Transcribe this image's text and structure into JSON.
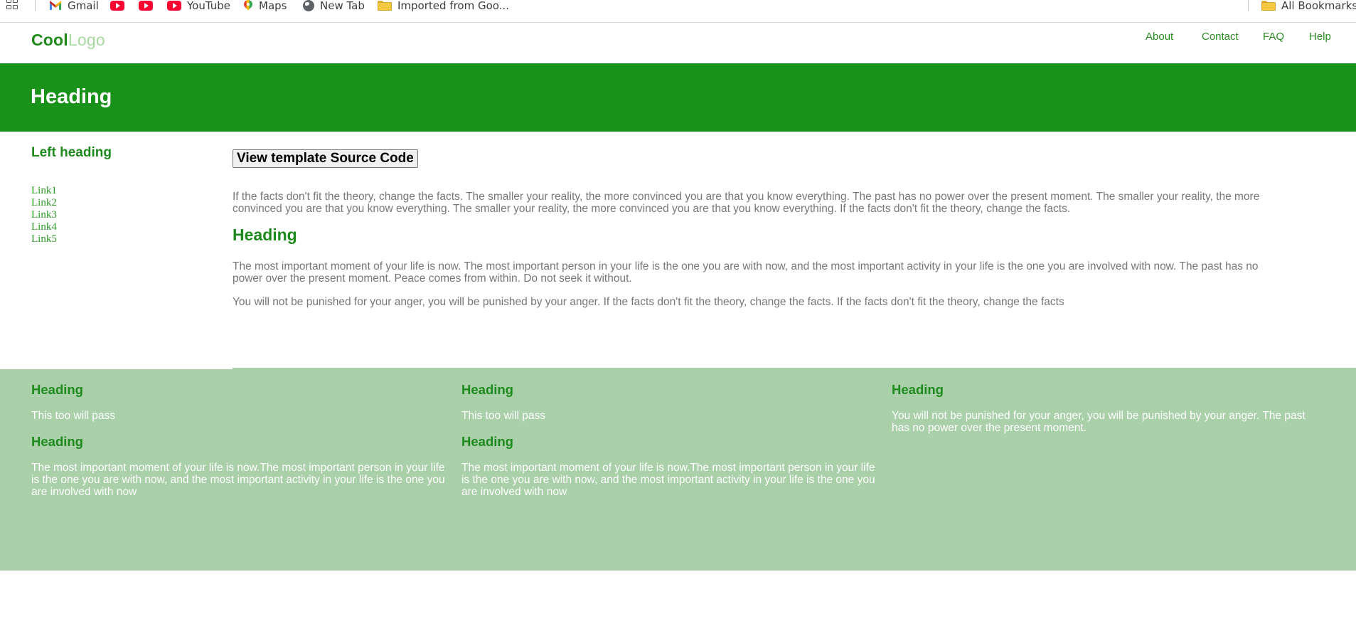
{
  "bookmarks_bar": {
    "items": [
      {
        "label": "Gmail",
        "icon": "gmail-icon"
      },
      {
        "label": "",
        "icon": "youtube-icon"
      },
      {
        "label": "",
        "icon": "youtube-icon"
      },
      {
        "label": "YouTube",
        "icon": "youtube-icon"
      },
      {
        "label": "Maps",
        "icon": "maps-icon"
      },
      {
        "label": "New Tab",
        "icon": "globe-icon"
      },
      {
        "label": "Imported from Goo...",
        "icon": "folder-icon"
      }
    ],
    "all_bookmarks": "All Bookmarks"
  },
  "header": {
    "logo_part1": "Cool",
    "logo_part2": "Logo",
    "nav": [
      "About",
      "Contact",
      "FAQ",
      "Help"
    ]
  },
  "banner": {
    "title": "Heading"
  },
  "sidebar": {
    "heading": "Left heading",
    "links": [
      "Link1",
      "Link2",
      "Link3",
      "Link4",
      "Link5"
    ]
  },
  "main": {
    "button_label": "View template Source Code",
    "paragraph1": "If the facts don't fit the theory, change the facts. The smaller your reality, the more convinced you are that you know everything. The past has no power over the present moment. The smaller your reality, the more convinced you are that you know everything. The smaller your reality, the more convinced you are that you know everything. If the facts don't fit the theory, change the facts.",
    "heading": "Heading",
    "paragraph2": "The most important moment of your life is now. The most important person in your life is the one you are with now, and the most important activity in your life is the one you are involved with now. The past has no power over the present moment. Peace comes from within. Do not seek it without.",
    "paragraph3": "You will not be punished for your anger, you will be punished by your anger. If the facts don't fit the theory, change the facts. If the facts don't fit the theory, change the facts"
  },
  "footer": {
    "columns": [
      {
        "heading1": "Heading",
        "text1": "This too will pass",
        "heading2": "Heading",
        "text2": "The most important moment of your life is now.The most important person in your life is the one you are with now, and the most important activity in your life is the one you are involved with now"
      },
      {
        "heading1": "Heading",
        "text1": "This too will pass",
        "heading2": "Heading",
        "text2": "The most important moment of your life is now.The most important person in your life is the one you are with now, and the most important activity in your life is the one you are involved with now"
      },
      {
        "heading1": "Heading",
        "text1": "You will not be punished for your anger, you will be punished by your anger. The past has no power over the present moment."
      }
    ]
  },
  "colors": {
    "brand_green": "#19921a",
    "heading_green": "#1e8a1d",
    "logo_light": "#a7d79f",
    "footer_bg": "#a9d0a9",
    "body_text": "#777777"
  }
}
